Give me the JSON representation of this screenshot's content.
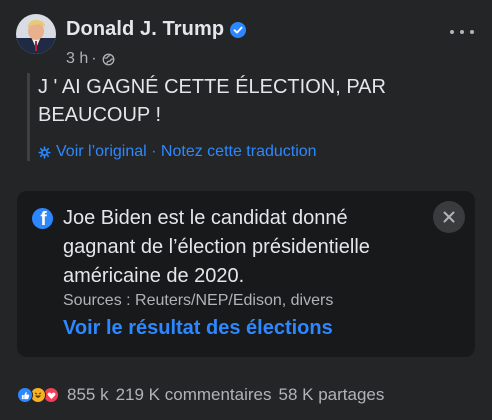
{
  "post": {
    "author": "Donald J. Trump",
    "time": "3 h",
    "separator": "·",
    "text": "J ' AI GAGNÉ CETTE ÉLECTION, PAR BEAUCOUP !",
    "translation_links": "Voir l’original · Notez cette traduction"
  },
  "info_box": {
    "text": "Joe Biden est le candidat donné gagnant de l’élection présidentielle américaine de 2020.",
    "sources": "Sources : Reuters/NEP/Edison, divers",
    "link": "Voir le résultat des élections"
  },
  "footer": {
    "reactions_count": "855 k",
    "comments": "219 K commentaires",
    "shares": "58 K partages"
  },
  "colors": {
    "background": "#242526",
    "link": "#2d88ff",
    "secondary_text": "#b0b3b8"
  },
  "icons": [
    "verified-badge-icon",
    "globe-icon",
    "more-options-icon",
    "translate-gear-icon",
    "facebook-icon",
    "close-icon",
    "like-reaction-icon",
    "haha-reaction-icon",
    "love-reaction-icon"
  ]
}
